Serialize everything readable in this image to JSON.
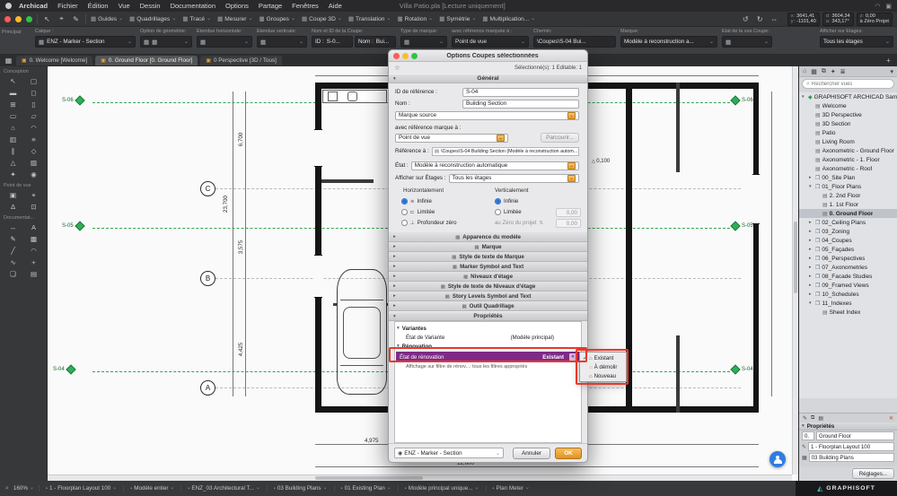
{
  "menubar": {
    "window_title": "Villa Patio.pla [Lecture uniquement]",
    "items": [
      "Archicad",
      "Fichier",
      "Édition",
      "Vue",
      "Dessin",
      "Documentation",
      "Options",
      "Partage",
      "Fenêtres",
      "Aide"
    ]
  },
  "toolbar": {
    "groups": [
      "Guides",
      "Quadrillages",
      "Tracé",
      "Mesurer",
      "Groupes",
      "Coupe 3D",
      "Translation",
      "Rotation",
      "Symétrie",
      "Multiplication..."
    ],
    "tracker": {
      "x_label": "x:",
      "x": "3641,41",
      "y_label": "y:",
      "y": "-1101,40",
      "d_label": "d:",
      "d": "3604,34",
      "a_label": "a:",
      "a": "343,17°",
      "z_label": "z:",
      "z": "0,00",
      "z_ref": "à Zéro Projet"
    }
  },
  "infobar": {
    "panel_title": "Principal",
    "calque_label": "Calque :",
    "calque_value": "ENZ - Marker - Section",
    "geometry_label": "Option de géométrie:",
    "extent_h_label": "Étendue horizontale:",
    "extent_v_label": "Étendue verticale:",
    "name_id_label": "Nom et ID de la Coupe:",
    "id_label": "ID :",
    "id_value": "S-0...",
    "name_label": "Nom :",
    "name_value": "Bui...",
    "mark_type_label": "Type de marque:",
    "ref_label": "avec référence marquée à :",
    "ref_value": "Point de vue",
    "path_label": "Chemin:",
    "path_value": "\\Coupes\\S-04 Bui...",
    "mark_label": "Marque:",
    "mark_value": "Modèle à reconstruction a...",
    "view_state_label": "État de la vue Coupe:",
    "stories_label": "Afficher sur Étages:",
    "stories_value": "Tous les étages"
  },
  "tabs": [
    {
      "label": "0. Welcome [Welcome]"
    },
    {
      "label": "0. Ground Floor [0. Ground Floor]",
      "selected": true
    },
    {
      "label": "0 Perspective [3D / Tous]"
    }
  ],
  "toolbox": {
    "sections": [
      "Conception",
      "Point de vue",
      "Documentat..."
    ],
    "conception": [
      {
        "name": "tool-select-arrow",
        "glyph": "↖"
      },
      {
        "name": "tool-marquee",
        "glyph": "▢"
      },
      {
        "name": "tool-wall",
        "glyph": "▬"
      },
      {
        "name": "tool-door",
        "glyph": "◻"
      },
      {
        "name": "tool-window",
        "glyph": "⊞"
      },
      {
        "name": "tool-column",
        "glyph": "▯"
      },
      {
        "name": "tool-beam",
        "glyph": "▭"
      },
      {
        "name": "tool-slab",
        "glyph": "▱"
      },
      {
        "name": "tool-roof",
        "glyph": "⌂"
      },
      {
        "name": "tool-shell",
        "glyph": "◠"
      },
      {
        "name": "tool-curtain-wall",
        "glyph": "▥"
      },
      {
        "name": "tool-stair",
        "glyph": "≡"
      },
      {
        "name": "tool-railing",
        "glyph": "∥"
      },
      {
        "name": "tool-morph",
        "glyph": "◇"
      },
      {
        "name": "tool-mesh",
        "glyph": "△"
      },
      {
        "name": "tool-zone",
        "glyph": "▨"
      },
      {
        "name": "tool-object",
        "glyph": "✦"
      },
      {
        "name": "tool-lamp",
        "glyph": "◉"
      }
    ],
    "pointofview": [
      {
        "name": "tool-camera",
        "glyph": "▣"
      },
      {
        "name": "tool-section",
        "glyph": "⌖"
      },
      {
        "name": "tool-elevation",
        "glyph": "∆"
      },
      {
        "name": "tool-interior-elevation",
        "glyph": "⊡"
      }
    ],
    "documentation": [
      {
        "name": "tool-dimension",
        "glyph": "↔"
      },
      {
        "name": "tool-text",
        "glyph": "A"
      },
      {
        "name": "tool-label",
        "glyph": "✎"
      },
      {
        "name": "tool-fill",
        "glyph": "▩"
      },
      {
        "name": "tool-line",
        "glyph": "╱"
      },
      {
        "name": "tool-arc",
        "glyph": "◠"
      },
      {
        "name": "tool-spline",
        "glyph": "∿"
      },
      {
        "name": "tool-hotspot",
        "glyph": "+"
      },
      {
        "name": "tool-figure",
        "glyph": "❏"
      },
      {
        "name": "tool-drawing",
        "glyph": "▤"
      }
    ]
  },
  "canvas": {
    "markers": [
      {
        "id": "S-06",
        "side": "left"
      },
      {
        "id": "S-05",
        "side": "left"
      },
      {
        "id": "S-04",
        "side": "left"
      },
      {
        "id": "S-06",
        "side": "right"
      },
      {
        "id": "S-05",
        "side": "right"
      },
      {
        "id": "S-04",
        "side": "right"
      }
    ],
    "grid": [
      "C",
      "B",
      "A"
    ],
    "dims": {
      "d1": "23,700",
      "d2": "6,700",
      "d3": "3,575",
      "d4": "4,425",
      "d5": "4,975",
      "d6": "12,600",
      "elev": "0,100"
    }
  },
  "dialog": {
    "title": "Options Coupes sélectionnées",
    "selection_info": "Sélectionné(s): 1 Editable: 1",
    "general": {
      "header": "Général",
      "ref_id_label": "ID de référence :",
      "ref_id_value": "S-04",
      "name_label": "Nom :",
      "name_value": "Building Section",
      "source_mark": "Marque source",
      "with_ref_label": "avec référence marque à :",
      "viewpoint": "Point de vue",
      "browse_button": "Parcourir...",
      "reference_label": "Référence à :",
      "reference_value": "\\Coupes\\S-04 Building Section (Modèle à reconstruction autom...",
      "state_label": "État :",
      "state_value": "Modèle à reconstruction automatique",
      "show_on_label": "Afficher sur Étages :",
      "show_on_value": "Tous les étages",
      "horizontal_label": "Horizontalement",
      "vertical_label": "Verticalement",
      "h_options": [
        "Infinie",
        "Limitée",
        "Profondeur zéro"
      ],
      "v_options": [
        "Infinie",
        "Limitée"
      ],
      "zero_ref": "au Zéro du projet",
      "v_field1": "0,00",
      "v_field2": "0,00"
    },
    "collapsed_sections": [
      "Apparence du modèle",
      "Marque",
      "Style de texte de Marque",
      "Marker Symbol and Text",
      "Niveaux d'étage",
      "Style de texte de Niveaux d'étage",
      "Story Levels Symbol and Text",
      "Outil Quadrillage"
    ],
    "properties": {
      "header": "Propriétés",
      "variants_group": "Variantes",
      "variant_state_label": "État de Variante",
      "variant_state_value": "(Modèle principal)",
      "renovation_group": "Rénovation",
      "renovation_state_label": "État de rénovation",
      "renovation_state_value": "Existant",
      "renovation_filter_note": "Affichage sur filtre de rénov...: tous les filtres appropriés"
    },
    "footer": {
      "layer_value": "ENZ - Marker - Section",
      "cancel": "Annuler",
      "ok": "OK"
    }
  },
  "popup": {
    "items": [
      {
        "label": "Existant",
        "checked": true
      },
      {
        "label": "À démolir"
      },
      {
        "label": "Nouveau"
      }
    ]
  },
  "navigator": {
    "search_placeholder": "Rechercher vues",
    "tree": [
      {
        "label": "GRAPHISOFT ARCHICAD Sample Project",
        "level": 0,
        "type": "project",
        "expanded": true
      },
      {
        "label": "Welcome",
        "level": 1,
        "type": "view"
      },
      {
        "label": "3D Perspective",
        "level": 1,
        "type": "view"
      },
      {
        "label": "3D Section",
        "level": 1,
        "type": "view"
      },
      {
        "label": "Patio",
        "level": 1,
        "type": "view"
      },
      {
        "label": "Living Room",
        "level": 1,
        "type": "view"
      },
      {
        "label": "Axonometric - Ground Floor",
        "level": 1,
        "type": "view"
      },
      {
        "label": "Axonometric - 1. Floor",
        "level": 1,
        "type": "view"
      },
      {
        "label": "Axonometric - Roof",
        "level": 1,
        "type": "view"
      },
      {
        "label": "00_Site Plan",
        "level": 1,
        "type": "folder",
        "expanded": false
      },
      {
        "label": "01_Floor Plans",
        "level": 1,
        "type": "folder",
        "expanded": true
      },
      {
        "label": "2. 2nd Floor",
        "level": 2,
        "type": "view"
      },
      {
        "label": "1. 1st Floor",
        "level": 2,
        "type": "view"
      },
      {
        "label": "0. Ground Floor",
        "level": 2,
        "type": "view",
        "selected": true
      },
      {
        "label": "02_Ceiling Plans",
        "level": 1,
        "type": "folder",
        "expanded": false
      },
      {
        "label": "03_Zoning",
        "level": 1,
        "type": "folder",
        "expanded": false
      },
      {
        "label": "04_Coupes",
        "level": 1,
        "type": "folder",
        "expanded": false
      },
      {
        "label": "05_Façades",
        "level": 1,
        "type": "folder",
        "expanded": false
      },
      {
        "label": "06_Perspectives",
        "level": 1,
        "type": "folder",
        "expanded": false
      },
      {
        "label": "07_Axonometries",
        "level": 1,
        "type": "folder",
        "expanded": false
      },
      {
        "label": "08_Facade Studies",
        "level": 1,
        "type": "folder",
        "expanded": false
      },
      {
        "label": "09_Framed Views",
        "level": 1,
        "type": "folder",
        "expanded": false
      },
      {
        "label": "10_Schedules",
        "level": 1,
        "type": "folder",
        "expanded": false
      },
      {
        "label": "11_Indexes",
        "level": 1,
        "type": "folder",
        "expanded": true
      },
      {
        "label": "Sheet Index",
        "level": 2,
        "type": "view"
      }
    ],
    "properties_panel": {
      "header": "Propriétés",
      "story_number": "0.",
      "story_name": "Ground Floor",
      "layout": "1 - Floorplan Layout 100",
      "subset": "03 Building Plans",
      "settings_button": "Réglages..."
    }
  },
  "statusbar": {
    "zoom": "160%",
    "items": [
      "1 - Floorplan Layout 100",
      "Modèle entier",
      "ENZ_03 Architectural T...",
      "03 Building Plans",
      "01 Existing Plan",
      "Modèle principal unique...",
      "Plan Meter"
    ],
    "brand": "GRAPHISOFT"
  }
}
